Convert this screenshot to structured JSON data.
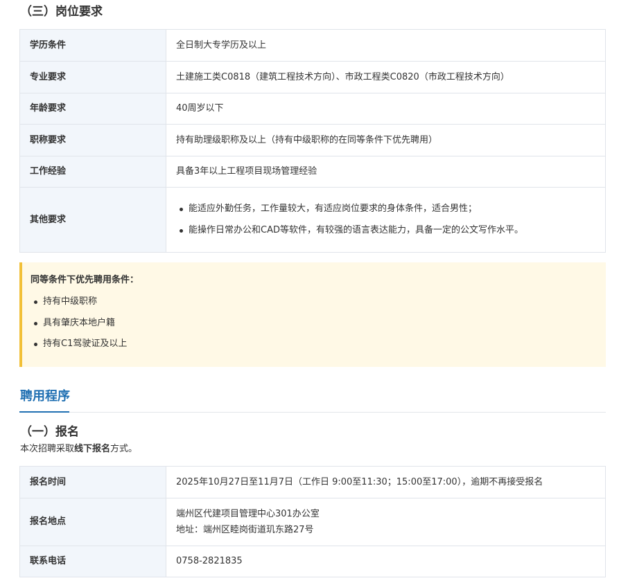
{
  "requirements": {
    "heading": "（三）岗位要求",
    "rows": [
      {
        "label": "学历条件",
        "value": "全日制大专学历及以上"
      },
      {
        "label": "专业要求",
        "value": "土建施工类C0818（建筑工程技术方向）、市政工程类C0820（市政工程技术方向）"
      },
      {
        "label": "年龄要求",
        "value": "40周岁以下"
      },
      {
        "label": "职称要求",
        "value": "持有助理级职称及以上（持有中级职称的在同等条件下优先聘用）"
      },
      {
        "label": "工作经验",
        "value": "具备3年以上工程项目现场管理经验"
      }
    ],
    "other": {
      "label": "其他要求",
      "items": [
        "能适应外勤任务，工作量较大，有适应岗位要求的身体条件，适合男性；",
        "能操作日常办公和CAD等软件，有较强的语言表达能力，具备一定的公文写作水平。"
      ]
    }
  },
  "priority_note": {
    "title": "同等条件下优先聘用条件：",
    "items": [
      "持有中级职称",
      "具有肇庆本地户籍",
      "持有C1驾驶证及以上"
    ]
  },
  "procedure": {
    "title": "聘用程序",
    "subheading": "（一）报名",
    "intro_before": "本次招聘采取",
    "intro_bold": "线下报名",
    "intro_after": "方式。",
    "rows": {
      "time": {
        "label": "报名时间",
        "value": "2025年10月27日至11月7日（工作日 9:00至11:30；15:00至17:00），逾期不再接受报名"
      },
      "place": {
        "label": "报名地点",
        "value_line1": "端州区代建项目管理中心301办公室",
        "value_line2": "地址：端州区睦岗街道玑东路27号"
      },
      "phone": {
        "label": "联系电话",
        "value": "0758-2821835"
      }
    }
  },
  "colors": {
    "accent_blue": "#1f6fb2",
    "note_border": "#f2c037",
    "note_background": "#fff9e6",
    "label_cell_background": "#f2f6fb"
  }
}
